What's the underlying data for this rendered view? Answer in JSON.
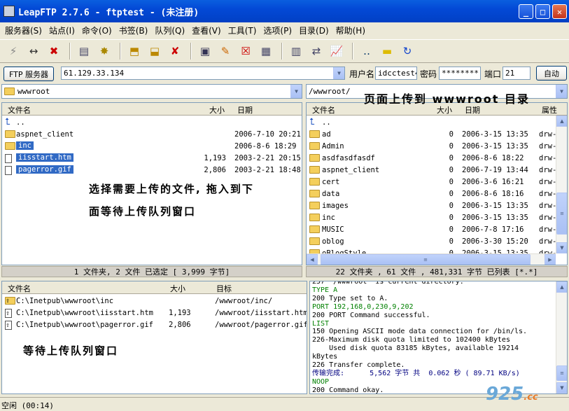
{
  "window": {
    "title": "LeapFTP 2.7.6 - ftptest - (未注册)",
    "buttons": {
      "minimize": "_",
      "maximize": "□",
      "close": "✕"
    }
  },
  "menu": [
    "服务器(S)",
    "站点(I)",
    "命令(O)",
    "书签(B)",
    "队列(Q)",
    "查看(V)",
    "工具(T)",
    "选项(P)",
    "目录(D)",
    "帮助(H)"
  ],
  "connection": {
    "server_button": "FTP 服务器",
    "server": "61.129.33.134",
    "user_label": "用户名",
    "user": "idcctest4",
    "password_label": "密码",
    "password": "********",
    "port_label": "端口",
    "port": "21",
    "auto_button": "自动"
  },
  "local": {
    "path": "wwwroot",
    "columns": {
      "name": "文件名",
      "size": "大小",
      "date": "日期"
    },
    "files": [
      {
        "name": "..",
        "size": "",
        "date": "",
        "type": "up",
        "selected": false
      },
      {
        "name": "aspnet_client",
        "size": "",
        "date": "2006-7-10 20:21",
        "type": "folder",
        "selected": false
      },
      {
        "name": "inc",
        "size": "",
        "date": "2006-8-6 18:29",
        "type": "folder",
        "selected": true
      },
      {
        "name": "iisstart.htm",
        "size": "1,193",
        "date": "2003-2-21 20:15",
        "type": "file",
        "selected": true
      },
      {
        "name": "pagerror.gif",
        "size": "2,806",
        "date": "2003-2-21 18:48",
        "type": "file",
        "selected": true
      }
    ],
    "status": "1 文件夹, 2 文件  已选定 [  3,999 字节]"
  },
  "remote": {
    "path": "/wwwroot/",
    "columns": {
      "name": "文件名",
      "size": "大小",
      "date": "日期",
      "attr": "属性"
    },
    "files": [
      {
        "name": "..",
        "size": "",
        "date": "",
        "attr": "",
        "type": "up"
      },
      {
        "name": "ad",
        "size": "0",
        "date": "2006-3-15 13:35",
        "attr": "drw-",
        "type": "folder"
      },
      {
        "name": "Admin",
        "size": "0",
        "date": "2006-3-15 13:35",
        "attr": "drw-",
        "type": "folder"
      },
      {
        "name": "asdfasdfasdf",
        "size": "0",
        "date": "2006-8-6 18:22",
        "attr": "drw-",
        "type": "folder"
      },
      {
        "name": "aspnet_client",
        "size": "0",
        "date": "2006-7-19 13:44",
        "attr": "drw-",
        "type": "folder"
      },
      {
        "name": "cert",
        "size": "0",
        "date": "2006-3-6 16:21",
        "attr": "drw-",
        "type": "folder"
      },
      {
        "name": "data",
        "size": "0",
        "date": "2006-8-6 18:16",
        "attr": "drw-",
        "type": "folder"
      },
      {
        "name": "images",
        "size": "0",
        "date": "2006-3-15 13:35",
        "attr": "drw-",
        "type": "folder"
      },
      {
        "name": "inc",
        "size": "0",
        "date": "2006-3-15 13:35",
        "attr": "drw-",
        "type": "folder"
      },
      {
        "name": "MUSIC",
        "size": "0",
        "date": "2006-7-8 17:16",
        "attr": "drw-",
        "type": "folder"
      },
      {
        "name": "oblog",
        "size": "0",
        "date": "2006-3-30 15:20",
        "attr": "drw-",
        "type": "folder"
      },
      {
        "name": "oBlogStyle",
        "size": "0",
        "date": "2006-3-15 13:35",
        "attr": "drw-",
        "type": "folder"
      }
    ],
    "status": "22 文件夹 , 61 文件 , 481,331 字节  已列表 [*.*]"
  },
  "queue": {
    "columns": {
      "name": "文件名",
      "size": "大小",
      "target": "目标"
    },
    "items": [
      {
        "name": "C:\\Inetpub\\wwwroot\\inc",
        "size": "",
        "target": "/wwwroot/inc/",
        "type": "folder-up"
      },
      {
        "name": "C:\\Inetpub\\wwwroot\\iisstart.htm",
        "size": "1,193",
        "target": "/wwwroot/iisstart.htm",
        "type": "file-up"
      },
      {
        "name": "C:\\Inetpub\\wwwroot\\pagerror.gif",
        "size": "2,806",
        "target": "/wwwroot/pagerror.gif",
        "type": "file-up"
      }
    ]
  },
  "log": [
    {
      "text": "257 \"/wwwroot\" is current directory.",
      "color": "#000000"
    },
    {
      "text": "TYPE A",
      "color": "#008000"
    },
    {
      "text": "200 Type set to A.",
      "color": "#000000"
    },
    {
      "text": "PORT 192,168,0,230,9,202",
      "color": "#008000"
    },
    {
      "text": "200 PORT Command successful.",
      "color": "#000000"
    },
    {
      "text": "LIST",
      "color": "#008000"
    },
    {
      "text": "150 Opening ASCII mode data connection for /bin/ls.",
      "color": "#000000"
    },
    {
      "text": "226-Maximum disk quota limited to 102400 kBytes",
      "color": "#000000"
    },
    {
      "text": "    Used disk quota 83185 kBytes, available 19214",
      "color": "#000000"
    },
    {
      "text": "kBytes",
      "color": "#000000"
    },
    {
      "text": "226 Transfer complete.",
      "color": "#000000"
    },
    {
      "text": "传输完成:      5,562 字节 共  0.062 秒 ( 89.71 KB/s)",
      "color": "#000080"
    },
    {
      "text": "NOOP",
      "color": "#008000"
    },
    {
      "text": "200 Command okay.",
      "color": "#000000"
    }
  ],
  "statusbar": {
    "text": "空闲 (00:14)"
  },
  "annotations": {
    "remote_hint": "页面上传到 wwwroot 目录",
    "local_hint_1": "选择需要上传的文件, 拖入到下",
    "local_hint_2": "面等待上传队列窗口",
    "queue_hint": "等待上传队列窗口"
  },
  "watermark": {
    "main": "925",
    "suffix": ".cc"
  },
  "colors": {
    "selection": "#316ac5",
    "titlebar": "#0349d6",
    "log_command": "#008000"
  }
}
